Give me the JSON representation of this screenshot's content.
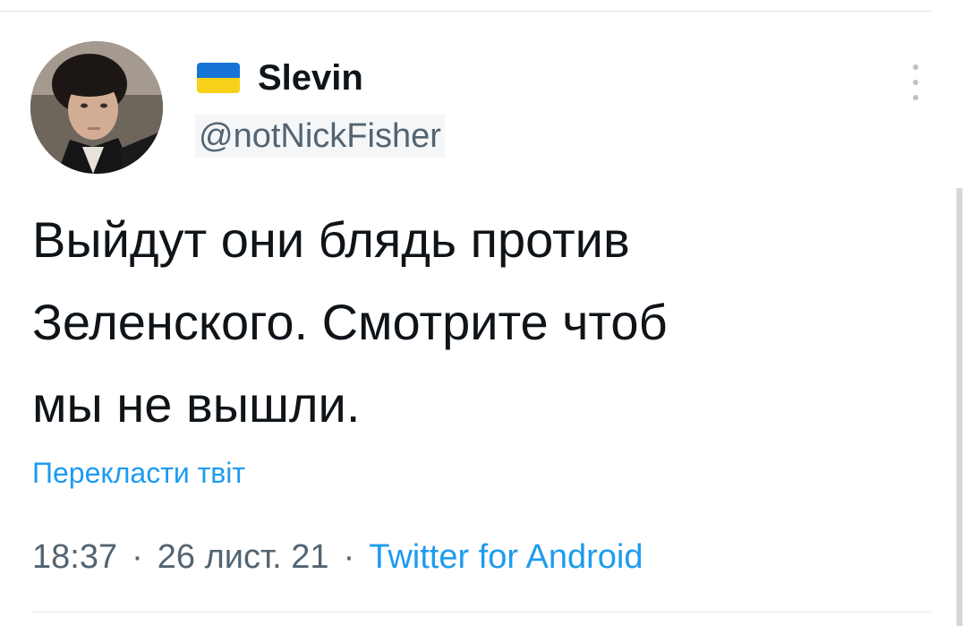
{
  "tweet": {
    "author": {
      "flag_colors": {
        "blue": "#1574d6",
        "yellow": "#f7d11a"
      },
      "display_name": "Slevin",
      "handle": "@notNickFisher"
    },
    "text_lines": [
      "Выйдут они блядь против",
      "Зеленского. Смотрите чтоб",
      "мы не вышли."
    ],
    "translate_label": "Перекласти твіт",
    "meta": {
      "time": "18:37",
      "separator": "·",
      "date": "26 лист. 21",
      "source": "Twitter for Android"
    },
    "more_icon": "more-vertical-icon"
  },
  "colors": {
    "link": "#1d9bf0",
    "text_primary": "#0f1419",
    "text_secondary": "#536471"
  }
}
